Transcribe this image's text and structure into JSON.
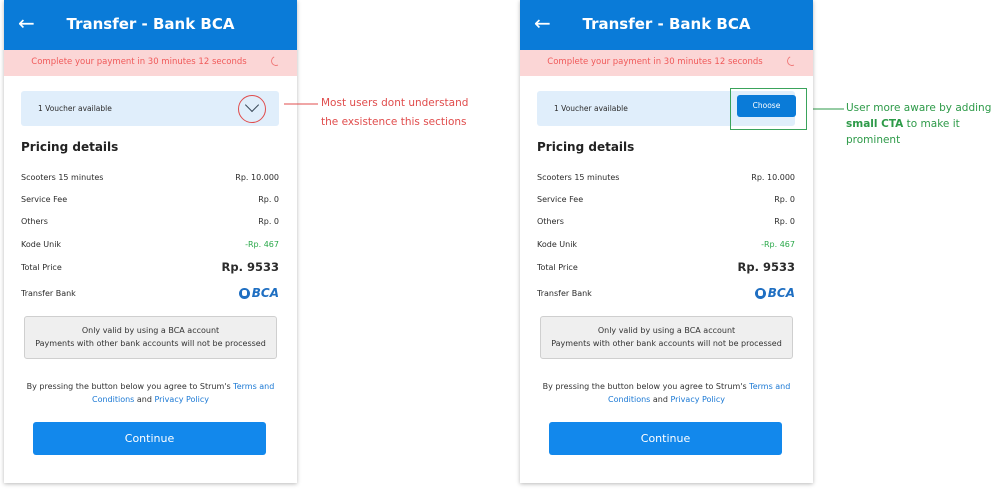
{
  "screens": [
    {
      "header": {
        "back_icon": "arrow-left-icon",
        "title": "Transfer - Bank BCA"
      },
      "timer": {
        "text": "Complete your payment in 30 minutes 12 seconds"
      },
      "voucher": {
        "text": "1 Voucher available"
      },
      "pricing": {
        "title": "Pricing details",
        "rows": [
          {
            "label": "Scooters 15 minutes",
            "value": "Rp. 10.000"
          },
          {
            "label": "Service Fee",
            "value": "Rp. 0"
          },
          {
            "label": "Others",
            "value": "Rp. 0"
          },
          {
            "label": "Kode Unik",
            "value": "-Rp. 467"
          },
          {
            "label": "Total Price",
            "value": "Rp. 9533"
          },
          {
            "label": "Transfer Bank",
            "value": "BCA"
          }
        ]
      },
      "notice": {
        "line1": "Only valid by using a BCA account",
        "line2": "Payments with other bank accounts will not be processed"
      },
      "agreement": {
        "prefix": "By pressing the button below you agree to Strum's",
        "terms": "Terms and Conditions",
        "and": "and",
        "privacy": "Privacy Policy"
      },
      "continue_label": "Continue"
    },
    {
      "header": {
        "back_icon": "arrow-left-icon",
        "title": "Transfer - Bank BCA"
      },
      "timer": {
        "text": "Complete your payment in 30 minutes 12 seconds"
      },
      "voucher": {
        "text": "1 Voucher available",
        "button": "Choose"
      },
      "pricing": {
        "title": "Pricing details",
        "rows": [
          {
            "label": "Scooters 15 minutes",
            "value": "Rp. 10.000"
          },
          {
            "label": "Service Fee",
            "value": "Rp. 0"
          },
          {
            "label": "Others",
            "value": "Rp. 0"
          },
          {
            "label": "Kode Unik",
            "value": "-Rp. 467"
          },
          {
            "label": "Total Price",
            "value": "Rp. 9533"
          },
          {
            "label": "Transfer Bank",
            "value": "BCA"
          }
        ]
      },
      "notice": {
        "line1": "Only valid by using a BCA account",
        "line2": "Payments with other bank accounts will not be processed"
      },
      "agreement": {
        "prefix": "By pressing the button below you agree to Strum's",
        "terms": "Terms and Conditions",
        "and": "and",
        "privacy": "Privacy Policy"
      },
      "continue_label": "Continue"
    }
  ],
  "annotations": {
    "left": {
      "line1": "Most users dont understand",
      "line2": "the exsistence this sections"
    },
    "right": {
      "pre": "User more aware by adding",
      "bold": "small CTA",
      "post": "to make it prominent"
    }
  },
  "colors": {
    "primary": "#0a7bd8",
    "timer_bg": "#fbd6d6",
    "timer_text": "#f05a5a",
    "annotation_red": "#e04c4c",
    "annotation_green": "#2d9a48"
  }
}
